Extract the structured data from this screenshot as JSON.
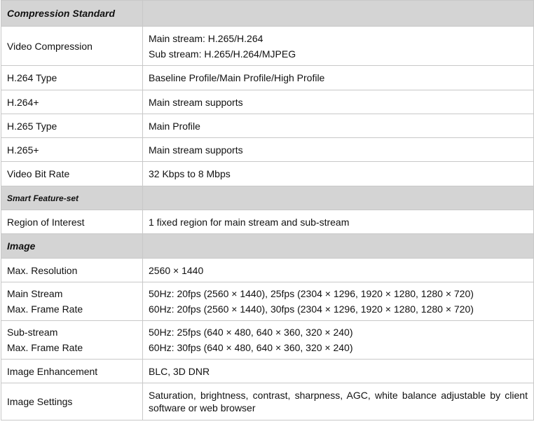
{
  "rows": [
    {
      "type": "section",
      "label": "Compression Standard"
    },
    {
      "type": "spec",
      "label": "Video Compression",
      "value": [
        "Main stream: H.265/H.264",
        "Sub stream: H.265/H.264/MJPEG"
      ]
    },
    {
      "type": "spec",
      "label": "H.264 Type",
      "value": [
        "Baseline Profile/Main Profile/High Profile"
      ]
    },
    {
      "type": "spec",
      "label": "H.264+",
      "value": [
        "Main stream supports"
      ]
    },
    {
      "type": "spec",
      "label": "H.265 Type",
      "value": [
        "Main Profile"
      ]
    },
    {
      "type": "spec",
      "label": "H.265+",
      "value": [
        "Main stream supports"
      ]
    },
    {
      "type": "spec",
      "label": "Video Bit Rate",
      "value": [
        "32 Kbps to 8 Mbps"
      ]
    },
    {
      "type": "section",
      "label": "Smart Feature-set"
    },
    {
      "type": "spec",
      "label": "Region of Interest",
      "value": [
        "1 fixed region for main stream and sub-stream"
      ]
    },
    {
      "type": "section",
      "label": "Image"
    },
    {
      "type": "spec",
      "label": "Max. Resolution",
      "value": [
        "2560 × 1440"
      ]
    },
    {
      "type": "spec",
      "label": [
        "Main Stream",
        "Max. Frame Rate"
      ],
      "value": [
        "50Hz: 20fps (2560 × 1440), 25fps (2304 × 1296, 1920 × 1280, 1280 × 720)",
        "60Hz: 20fps (2560 × 1440), 30fps (2304 × 1296, 1920 × 1280, 1280 × 720)"
      ]
    },
    {
      "type": "spec",
      "label": [
        "Sub-stream",
        "Max. Frame Rate"
      ],
      "value": [
        "50Hz: 25fps (640 × 480, 640 × 360, 320 × 240)",
        "60Hz: 30fps (640 × 480, 640 × 360, 320 × 240)"
      ]
    },
    {
      "type": "spec",
      "label": "Image Enhancement",
      "value": [
        "BLC, 3D DNR"
      ]
    },
    {
      "type": "spec",
      "label": "Image Settings",
      "value": [
        "Saturation, brightness, contrast, sharpness, AGC, white balance adjustable by client software or web browser"
      ]
    }
  ]
}
